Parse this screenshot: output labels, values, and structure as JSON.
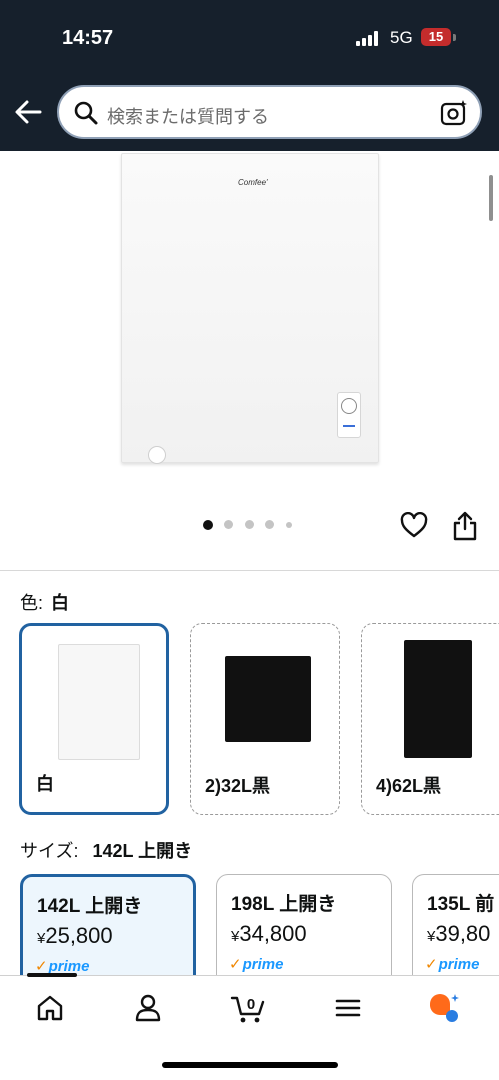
{
  "status": {
    "time": "14:57",
    "network": "5G",
    "battery": "15"
  },
  "search": {
    "placeholder": "検索または質問する"
  },
  "colors": {
    "header_bg": "#16202c",
    "selected_border": "#2162a1",
    "prime_blue": "#1a98ff",
    "prime_check": "#f08804",
    "rufus_orange": "#ff6a1a",
    "rufus_blue": "#2a7de1"
  },
  "gallery": {
    "image_count": 5,
    "active_index": 0,
    "brand_mark": "Comfee'"
  },
  "color_option": {
    "label": "色:",
    "selected": "白",
    "swatches": [
      {
        "name": "白",
        "selected": true
      },
      {
        "name": "2)32L黒",
        "selected": false
      },
      {
        "name": "4)62L黒",
        "selected": false
      }
    ]
  },
  "size_option": {
    "label": "サイズ:",
    "selected": "142L 上開き",
    "cards": [
      {
        "title": "142L 上開き",
        "currency": "¥",
        "price": "25,800",
        "prime": "prime",
        "selected": true
      },
      {
        "title": "198L 上開き",
        "currency": "¥",
        "price": "34,800",
        "prime": "prime",
        "selected": false
      },
      {
        "title": "135L 前",
        "currency": "¥",
        "price": "39,80",
        "prime": "prime",
        "selected": false
      }
    ]
  },
  "tabs": [
    {
      "icon": "home-icon"
    },
    {
      "icon": "account-icon"
    },
    {
      "icon": "cart-icon",
      "badge": "0"
    },
    {
      "icon": "menu-icon"
    },
    {
      "icon": "rufus-icon"
    }
  ]
}
